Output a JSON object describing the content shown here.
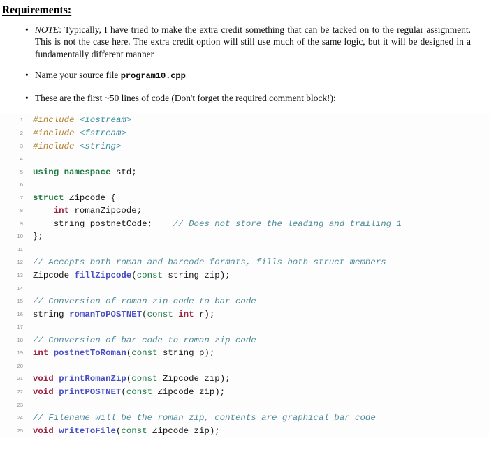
{
  "document": {
    "heading": "Requirements:",
    "bullet_glyph": "•",
    "requirements": [
      {
        "id": "note",
        "label": "NOTE",
        "label_suffix": ": ",
        "text": "Typically, I have tried to make the extra credit something that can be tacked on to the regular assignment. This is not the case here. The extra credit option will still use much of the same logic, but it will be designed in a fundamentally different manner"
      },
      {
        "id": "filename",
        "text_before": "Name your source file ",
        "mono": "program10.cpp",
        "text_after": ""
      },
      {
        "id": "lines",
        "text": "These are the first ~50 lines of code (Don't forget the required comment block!):"
      }
    ],
    "code": {
      "language": "cpp",
      "line_count": 25,
      "lines": [
        {
          "n": "1",
          "tokens": [
            {
              "t": "#include",
              "c": "pre"
            },
            {
              "t": " ",
              "c": "plain"
            },
            {
              "t": "<iostream>",
              "c": "header"
            }
          ]
        },
        {
          "n": "2",
          "tokens": [
            {
              "t": "#include",
              "c": "pre"
            },
            {
              "t": " ",
              "c": "plain"
            },
            {
              "t": "<fstream>",
              "c": "header"
            }
          ]
        },
        {
          "n": "3",
          "tokens": [
            {
              "t": "#include",
              "c": "pre"
            },
            {
              "t": " ",
              "c": "plain"
            },
            {
              "t": "<string>",
              "c": "header"
            }
          ]
        },
        {
          "n": "4",
          "tokens": []
        },
        {
          "n": "5",
          "tokens": [
            {
              "t": "using namespace",
              "c": "kw"
            },
            {
              "t": " std;",
              "c": "plain"
            }
          ]
        },
        {
          "n": "6",
          "tokens": []
        },
        {
          "n": "7",
          "tokens": [
            {
              "t": "struct",
              "c": "kw"
            },
            {
              "t": " Zipcode {",
              "c": "plain"
            }
          ]
        },
        {
          "n": "8",
          "tokens": [
            {
              "t": "    ",
              "c": "plain"
            },
            {
              "t": "int",
              "c": "type"
            },
            {
              "t": " romanZipcode;",
              "c": "plain"
            }
          ]
        },
        {
          "n": "9",
          "tokens": [
            {
              "t": "    string postnetCode;    ",
              "c": "plain"
            },
            {
              "t": "// Does not store the leading and trailing 1",
              "c": "cmt"
            }
          ]
        },
        {
          "n": "10",
          "tokens": [
            {
              "t": "};",
              "c": "plain"
            }
          ]
        },
        {
          "n": "11",
          "tokens": []
        },
        {
          "n": "12",
          "tokens": [
            {
              "t": "// Accepts both roman and barcode formats, fills both struct members",
              "c": "cmt"
            }
          ]
        },
        {
          "n": "13",
          "tokens": [
            {
              "t": "Zipcode ",
              "c": "plain"
            },
            {
              "t": "fillZipcode",
              "c": "fn"
            },
            {
              "t": "(",
              "c": "plain"
            },
            {
              "t": "const",
              "c": "const"
            },
            {
              "t": " string zip);",
              "c": "plain"
            }
          ]
        },
        {
          "n": "14",
          "tokens": []
        },
        {
          "n": "15",
          "tokens": [
            {
              "t": "// Conversion of roman zip code to bar code",
              "c": "cmt"
            }
          ]
        },
        {
          "n": "16",
          "tokens": [
            {
              "t": "string ",
              "c": "plain"
            },
            {
              "t": "romanToPOSTNET",
              "c": "fn"
            },
            {
              "t": "(",
              "c": "plain"
            },
            {
              "t": "const",
              "c": "const"
            },
            {
              "t": " ",
              "c": "plain"
            },
            {
              "t": "int",
              "c": "type"
            },
            {
              "t": " r);",
              "c": "plain"
            }
          ]
        },
        {
          "n": "17",
          "tokens": []
        },
        {
          "n": "18",
          "tokens": [
            {
              "t": "// Conversion of bar code to roman zip code",
              "c": "cmt"
            }
          ]
        },
        {
          "n": "19",
          "tokens": [
            {
              "t": "int",
              "c": "type"
            },
            {
              "t": " ",
              "c": "plain"
            },
            {
              "t": "postnetToRoman",
              "c": "fn"
            },
            {
              "t": "(",
              "c": "plain"
            },
            {
              "t": "const",
              "c": "const"
            },
            {
              "t": " string p);",
              "c": "plain"
            }
          ]
        },
        {
          "n": "20",
          "tokens": []
        },
        {
          "n": "21",
          "tokens": [
            {
              "t": "void",
              "c": "type"
            },
            {
              "t": " ",
              "c": "plain"
            },
            {
              "t": "printRomanZip",
              "c": "fn"
            },
            {
              "t": "(",
              "c": "plain"
            },
            {
              "t": "const",
              "c": "const"
            },
            {
              "t": " Zipcode zip);",
              "c": "plain"
            }
          ]
        },
        {
          "n": "22",
          "tokens": [
            {
              "t": "void",
              "c": "type"
            },
            {
              "t": " ",
              "c": "plain"
            },
            {
              "t": "printPOSTNET",
              "c": "fn"
            },
            {
              "t": "(",
              "c": "plain"
            },
            {
              "t": "const",
              "c": "const"
            },
            {
              "t": " Zipcode zip);",
              "c": "plain"
            }
          ]
        },
        {
          "n": "23",
          "tokens": []
        },
        {
          "n": "24",
          "tokens": [
            {
              "t": "// Filename will be the roman zip, contents are graphical bar code",
              "c": "cmt"
            }
          ]
        },
        {
          "n": "25",
          "tokens": [
            {
              "t": "void",
              "c": "type"
            },
            {
              "t": " ",
              "c": "plain"
            },
            {
              "t": "writeToFile",
              "c": "fn"
            },
            {
              "t": "(",
              "c": "plain"
            },
            {
              "t": "const",
              "c": "const"
            },
            {
              "t": " Zipcode zip);",
              "c": "plain"
            }
          ]
        }
      ]
    },
    "colors": {
      "preprocessor": "#b2802c",
      "header_name": "#3e8e9e",
      "keyword": "#1f7a45",
      "type": "#9b2340",
      "function": "#4a4ec4",
      "comment": "#4f8b99",
      "plain": "#141414",
      "line_number": "#8e8e8e",
      "page_background": "#ffffff"
    }
  }
}
